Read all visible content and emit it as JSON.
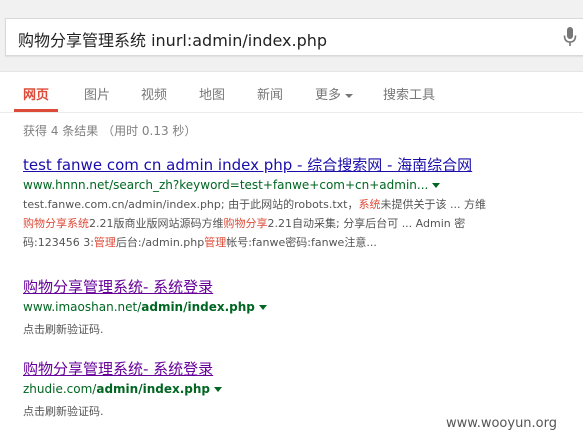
{
  "search": {
    "query": "购物分享管理系统 inurl:admin/index.php"
  },
  "tabs": [
    {
      "label": "网页",
      "active": true
    },
    {
      "label": "图片"
    },
    {
      "label": "视频"
    },
    {
      "label": "地图"
    },
    {
      "label": "新闻"
    },
    {
      "label": "更多"
    },
    {
      "label": "搜索工具"
    }
  ],
  "stats": "获得 4 条结果 （用时 0.13 秒）",
  "results": [
    {
      "title": "test fanwe com cn admin index php - 综合搜索网 - 海南综合网",
      "url": "www.hnnn.net/search_zh?keyword=test+fanwe+com+cn+admin...",
      "snippet": {
        "l1a": "test.fanwe.com.cn/admin/index.php; 由于此网站的robots.txt，",
        "l1b": "系统",
        "l1c": "未提供关于该 ... 方维",
        "l2a": "购物分享系统",
        "l2b": "2.21版商业版网站源码方维",
        "l2c": "购物分享",
        "l2d": "2.21自动采集; 分享后台可 ... Admin 密",
        "l3a": "码:123456 3:",
        "l3b": "管理",
        "l3c": "后台:/admin.php",
        "l3d": "管理",
        "l3e": "帐号:fanwe密码:fanwe注意..."
      }
    },
    {
      "title": "购物分享管理系统- 系统登录",
      "url_plain": "www.imaoshan.net/",
      "url_bold": "admin/index.php",
      "snippet": "点击刷新验证码."
    },
    {
      "title": "购物分享管理系统- 系统登录",
      "url_plain": "zhudie.com/",
      "url_bold": "admin/index.php",
      "snippet": "点击刷新验证码."
    }
  ],
  "watermark": "www.wooyun.org",
  "colors": {
    "accent": "#dd4b39",
    "link": "#1a0dab",
    "visited": "#660099",
    "url": "#006621"
  }
}
